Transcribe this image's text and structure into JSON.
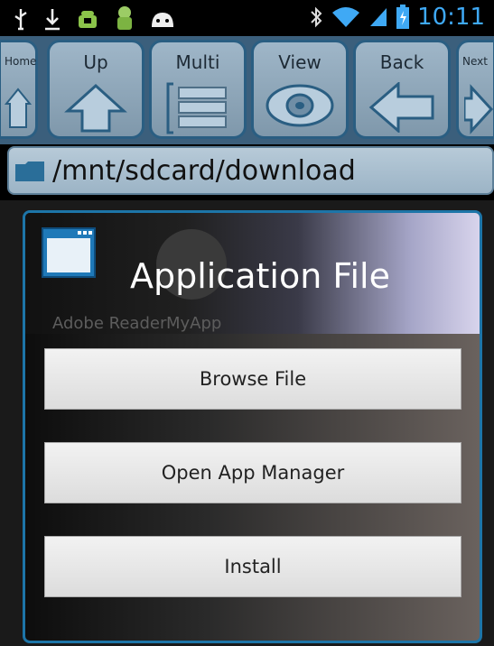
{
  "status_bar": {
    "icons": [
      "usb-icon",
      "download-icon",
      "android-icon",
      "android-robot-icon",
      "android-face-icon"
    ],
    "right_icons": [
      "bluetooth-icon",
      "wifi-icon",
      "signal-icon",
      "battery-icon"
    ],
    "time": "10:11"
  },
  "toolbar": {
    "home_label": "Home",
    "up_label": "Up",
    "multi_label": "Multi",
    "view_label": "View",
    "back_label": "Back",
    "next_label": "Next"
  },
  "path": {
    "current": "/mnt/sdcard/download"
  },
  "background_items": [
    {
      "label": "Adobe Reader"
    },
    {
      "label": "MyApp"
    }
  ],
  "dialog": {
    "title": "Application File",
    "buttons": {
      "browse": "Browse File",
      "open_manager": "Open App Manager",
      "install": "Install"
    }
  },
  "colors": {
    "accent": "#1d75a8",
    "toolbar": "#3b5f7c",
    "time": "#3fa9f5"
  }
}
